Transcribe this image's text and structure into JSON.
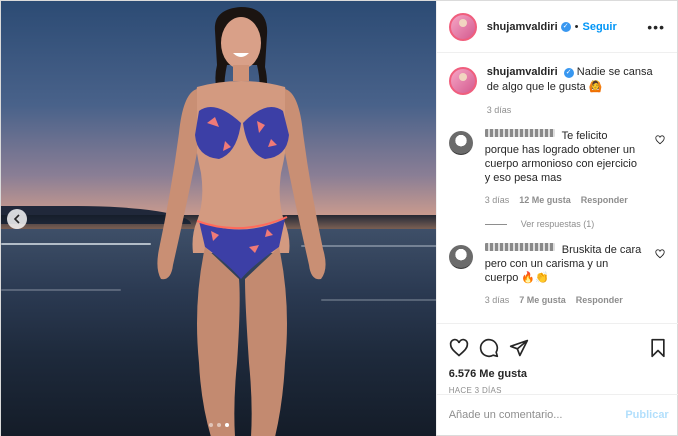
{
  "post": {
    "username": "shujamvaldiri",
    "follow_label": "Seguir",
    "follow_separator": "•",
    "more_label": "•••",
    "caption": "Nadie se cansa de algo que le gusta 🙆",
    "caption_time": "3 días"
  },
  "comments": [
    {
      "text": "Te felicito porque has logrado obtener un cuerpo armonioso con ejercicio y eso pesa mas",
      "time": "3 días",
      "likes": "12 Me gusta",
      "reply_label": "Responder",
      "view_replies": "Ver respuestas (1)"
    },
    {
      "text": "Bruskita de cara pero con un carisma y un cuerpo 🔥👏",
      "time": "3 días",
      "likes": "7 Me gusta",
      "reply_label": "Responder"
    }
  ],
  "footer": {
    "likes": "6.576 Me gusta",
    "date": "HACE 3 DÍAS",
    "comment_placeholder": "Añade un comentario...",
    "publish_label": "Publicar"
  },
  "icons": {
    "like": "heart-icon",
    "comment": "comment-icon",
    "share": "send-icon",
    "save": "bookmark-icon",
    "verified": "verified-badge-icon",
    "carousel_prev": "chevron-left-icon"
  },
  "carousel": {
    "total": 3,
    "active": 3
  },
  "colors": {
    "accent": "#0095f6",
    "verified": "#3897f0",
    "muted": "#8e8e8e"
  }
}
